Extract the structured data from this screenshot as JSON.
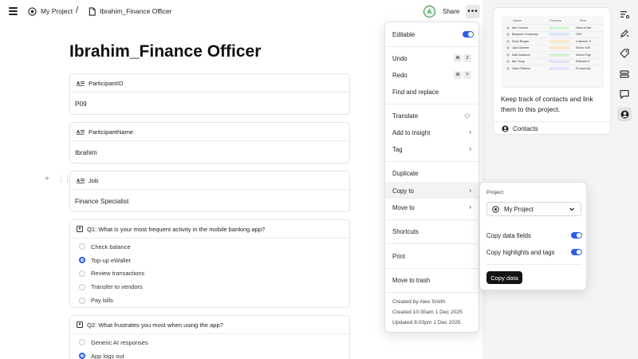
{
  "header": {
    "project": "My Project",
    "separator": "/",
    "document": "Ibrahim_Finance Officer",
    "avatar_initial": "A",
    "share_label": "Share",
    "more_label": "•••"
  },
  "page": {
    "title": "Ibrahim_Finance Officer",
    "fields": [
      {
        "label": "ParticipantID",
        "value": "P09"
      },
      {
        "label": "ParticipantName",
        "value": "Ibrahim"
      },
      {
        "label": "Job",
        "value": "Finance Specialist"
      }
    ],
    "questions": [
      {
        "label": "Q1: What is your most frequent activity in the mobile banking app?",
        "options": [
          "Check balance",
          "Top-up eWallet",
          "Review transactions",
          "Transfer to vendors",
          "Pay bills"
        ],
        "selected": 1
      },
      {
        "label": "Q2: What frustrates you most when using the app?",
        "options": [
          "Generic AI responses",
          "App logs out"
        ],
        "selected": 1
      }
    ]
  },
  "contacts": {
    "description": "Keep track of contacts and link them to this project.",
    "link_label": "Contacts",
    "preview": {
      "headers": [
        "Name",
        "Persona",
        "Role"
      ],
      "rows": [
        {
          "name": "Alex Younes",
          "persona": "Persona",
          "role": "Head of Sal"
        },
        {
          "name": "Benjamin Humphrey",
          "persona": "PM",
          "role": "CEO"
        },
        {
          "name": "Emily Brogan",
          "persona": "Creator",
          "role": "Customer S"
        },
        {
          "name": "Jack Gardner",
          "persona": "Creator",
          "role": "Senior Soft"
        },
        {
          "name": "Matt Davidson",
          "persona": "Persona",
          "role": "Senior Engi"
        },
        {
          "name": "Ben Yung",
          "persona": "Dev",
          "role": "Software E"
        },
        {
          "name": "Claire Fletcher",
          "persona": "Dev",
          "role": "Product Ma"
        }
      ]
    }
  },
  "menu": {
    "editable": "Editable",
    "undo": "Undo",
    "undo_keys": [
      "⌘",
      "Z"
    ],
    "redo": "Redo",
    "redo_keys": [
      "⌘",
      "Y"
    ],
    "find_replace": "Find and replace",
    "translate": "Translate",
    "add_to_insight": "Add to insight",
    "tag": "Tag",
    "duplicate": "Duplicate",
    "copy_to": "Copy to",
    "move_to": "Move to",
    "shortcuts": "Shortcuts",
    "print": "Print",
    "move_to_trash": "Move to trash",
    "created_by": "Created by Alex Smith",
    "created": "Created 10:30am 1 Dec 2025",
    "updated": "Updated 8:03pm 1 Dec 2025"
  },
  "submenu": {
    "project_label": "Project",
    "project_value": "My Project",
    "copy_fields": "Copy data fields",
    "copy_highlights": "Copy highlights and tags",
    "copy_button": "Copy data"
  },
  "colors": {
    "accent": "#2b5ee8",
    "avatar_green": "#2f8a3e"
  }
}
